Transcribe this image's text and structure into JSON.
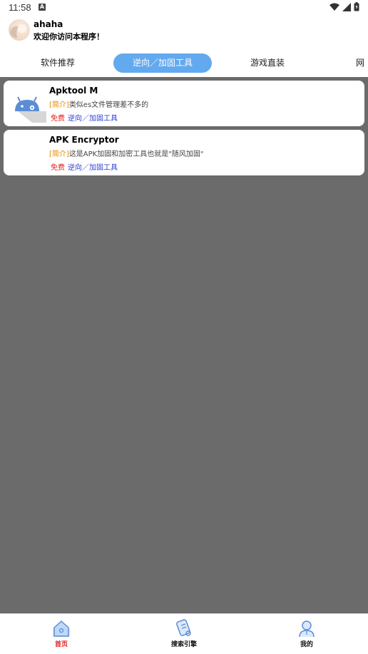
{
  "status": {
    "time": "11:58",
    "notif_badge": "A"
  },
  "header": {
    "username": "ahaha",
    "welcome": "欢迎你访问本程序！"
  },
  "tabs": [
    {
      "label": "软件推荐",
      "active": false
    },
    {
      "label": "逆向／加固工具",
      "active": true
    },
    {
      "label": "游戏直装",
      "active": false
    },
    {
      "label": "网",
      "active": false
    }
  ],
  "items": [
    {
      "title": "Apktool M",
      "desc_prefix": "[简介]",
      "desc": "类似es文件管理差不多的",
      "tag_free": "免费",
      "tag_category": "逆向／加固工具",
      "icon": "android-apktool-icon"
    },
    {
      "title": "APK Encryptor",
      "desc_prefix": "[简介]",
      "desc": "这是APK加固和加密工具也就是\"随风加固\"",
      "tag_free": "免费",
      "tag_category": "逆向／加固工具",
      "icon": ""
    }
  ],
  "nav": [
    {
      "label": "首页",
      "icon": "home-icon",
      "active": true
    },
    {
      "label": "搜索引擎",
      "icon": "search-engine-icon",
      "active": false
    },
    {
      "label": "我的",
      "icon": "profile-icon",
      "active": false
    }
  ],
  "colors": {
    "accent": "#63a9ef",
    "free_tag": "#e02020",
    "category_tag": "#2a3fd6",
    "bracket": "#e08a00",
    "list_background": "#6b6b6b"
  }
}
